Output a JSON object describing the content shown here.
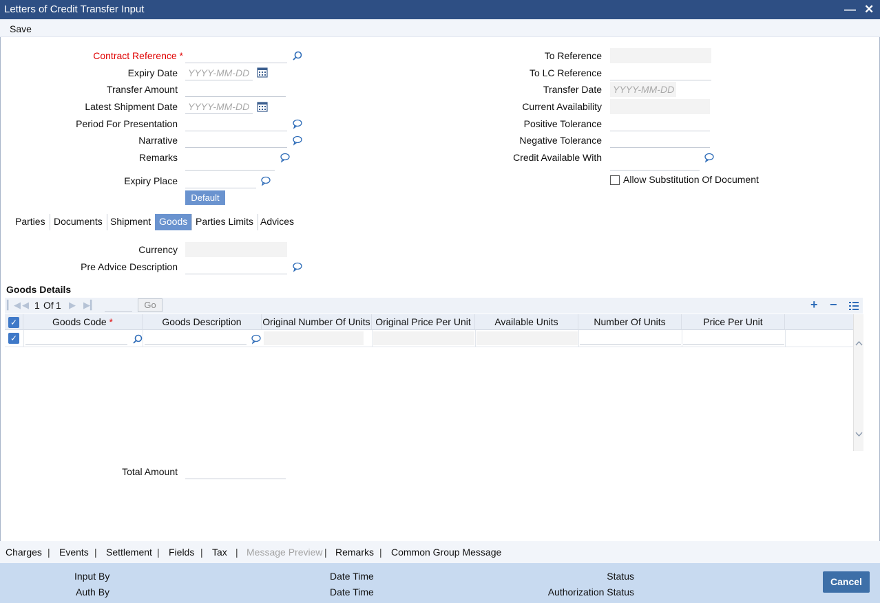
{
  "window": {
    "title": "Letters of Credit Transfer Input"
  },
  "toolbar": {
    "save_label": "Save"
  },
  "form_left": {
    "contract_reference": {
      "label": "Contract Reference",
      "required_mark": "*",
      "value": ""
    },
    "expiry_date": {
      "label": "Expiry Date",
      "placeholder": "YYYY-MM-DD"
    },
    "transfer_amount": {
      "label": "Transfer Amount",
      "value": ""
    },
    "latest_shipment_date": {
      "label": "Latest Shipment Date",
      "placeholder": "YYYY-MM-DD"
    },
    "period_for_presentation": {
      "label": "Period For Presentation",
      "value": ""
    },
    "narrative": {
      "label": "Narrative",
      "value": ""
    },
    "remarks": {
      "label": "Remarks",
      "value": ""
    },
    "expiry_place": {
      "label": "Expiry Place",
      "value": ""
    },
    "default_button": "Default"
  },
  "form_right": {
    "to_reference": {
      "label": "To Reference",
      "value": ""
    },
    "to_lc_reference": {
      "label": "To LC Reference",
      "value": ""
    },
    "transfer_date": {
      "label": "Transfer Date",
      "placeholder": "YYYY-MM-DD"
    },
    "current_availability": {
      "label": "Current Availability",
      "value": ""
    },
    "positive_tolerance": {
      "label": "Positive Tolerance",
      "value": ""
    },
    "negative_tolerance": {
      "label": "Negative Tolerance",
      "value": ""
    },
    "credit_available_with": {
      "label": "Credit Available With",
      "value": ""
    },
    "allow_substitution": {
      "label": "Allow Substitution Of Document",
      "checked": false
    }
  },
  "tabs": [
    {
      "label": "Parties",
      "active": false
    },
    {
      "label": "Documents",
      "active": false
    },
    {
      "label": "Shipment",
      "active": false
    },
    {
      "label": "Goods",
      "active": true
    },
    {
      "label": "Parties Limits",
      "active": false
    },
    {
      "label": "Advices",
      "active": false
    }
  ],
  "goods_tab": {
    "currency": {
      "label": "Currency",
      "value": ""
    },
    "pre_advice_description": {
      "label": "Pre Advice Description",
      "value": ""
    }
  },
  "goods_details": {
    "title": "Goods Details",
    "pager": {
      "current": "1",
      "of_label": "Of",
      "total": "1",
      "go_label": "Go"
    },
    "columns": [
      {
        "label": "Goods Code",
        "required_mark": "*"
      },
      {
        "label": "Goods Description"
      },
      {
        "label": "Original Number Of Units"
      },
      {
        "label": "Original Price Per Unit"
      },
      {
        "label": "Available Units"
      },
      {
        "label": "Number Of Units"
      },
      {
        "label": "Price Per Unit"
      }
    ],
    "rows": [
      {
        "checked": true,
        "goods_code": "",
        "goods_description": "",
        "original_number_of_units": "",
        "original_price_per_unit": "",
        "available_units": "",
        "number_of_units": "",
        "price_per_unit": ""
      }
    ],
    "total_amount": {
      "label": "Total Amount",
      "value": ""
    }
  },
  "footer_links": [
    "Charges",
    "Events",
    "Settlement",
    "Fields",
    "Tax",
    "Message Preview",
    "Remarks",
    "Common Group Message"
  ],
  "footer_links_disabled": [
    "Message Preview"
  ],
  "footer_info": {
    "input_by": "Input By",
    "auth_by": "Auth By",
    "date_time_1": "Date Time",
    "date_time_2": "Date Time",
    "status": "Status",
    "authorization_status": "Authorization Status",
    "cancel_label": "Cancel"
  },
  "colors": {
    "titlebar": "#2e4f84",
    "accent": "#6a93cf",
    "required": "#e00000",
    "footer": "#c8daf0"
  }
}
